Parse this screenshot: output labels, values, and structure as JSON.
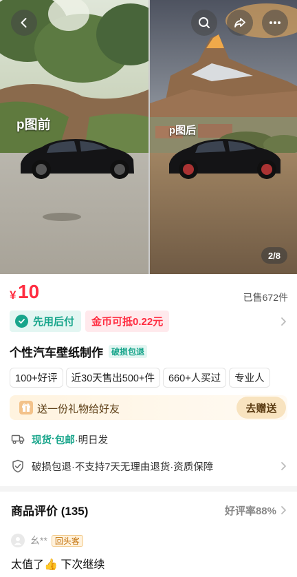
{
  "gallery": {
    "before_caption": "p图前",
    "after_caption": "p图后",
    "page_indicator": "2/8",
    "icons": [
      "chevron-left-icon",
      "search-icon",
      "share-icon",
      "more-icon"
    ]
  },
  "product": {
    "currency": "¥",
    "price": "10",
    "sold_count": "已售672件",
    "pay_later": "先用后付",
    "coin_offset": "金币可抵0.22元",
    "title": "个性汽车壁纸制作",
    "title_tag": "破损包退",
    "chips": [
      "100+好评",
      "近30天售出500+件",
      "660+人买过",
      "专业人"
    ]
  },
  "gift": {
    "text": "送一份礼物给好友",
    "button": "去赠送"
  },
  "shipping": {
    "stock": "现货",
    "separator": "·",
    "free": "包邮",
    "dispatch": "·明日发"
  },
  "guarantee": {
    "text": "破损包退·不支持7天无理由退货·资质保障"
  },
  "reviews": {
    "heading": "商品评价 (135)",
    "rating": "好评率88%",
    "reviewer_name": "幺**",
    "reviewer_badge": "回头客",
    "first_review": "太值了👍 下次继续"
  },
  "colors": {
    "price_red": "#ff2c40",
    "brand_green": "#18a58b",
    "gift_bg": "#fff3df"
  }
}
